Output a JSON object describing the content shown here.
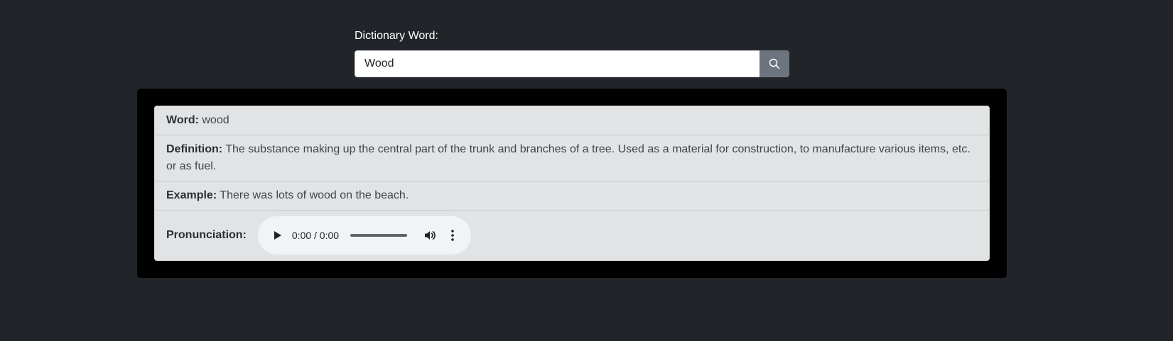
{
  "search": {
    "label": "Dictionary Word:",
    "value": "Wood",
    "button_icon": "search-icon"
  },
  "result": {
    "word_label": "Word:",
    "word": "wood",
    "definition_label": "Definition:",
    "definition": "The substance making up the central part of the trunk and branches of a tree. Used as a material for construction, to manufacture various items, etc. or as fuel.",
    "example_label": "Example:",
    "example": "There was lots of wood on the beach.",
    "pronunciation_label": "Pronunciation:",
    "audio": {
      "time": "0:00 / 0:00",
      "play_icon": "play-icon",
      "volume_icon": "volume-icon",
      "menu_icon": "more-vert-icon"
    }
  },
  "colors": {
    "page_background": "#212529",
    "panel_background": "#000000",
    "list_background": "#e2e3e5",
    "button_background": "#6c757d"
  }
}
